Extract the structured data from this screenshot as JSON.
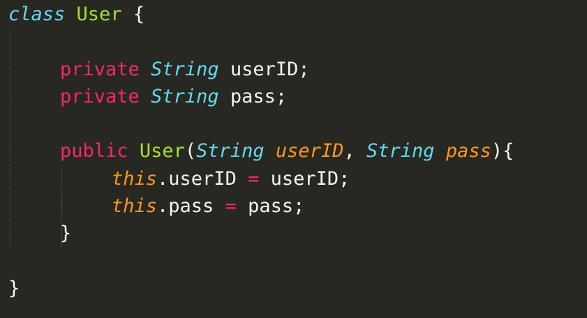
{
  "code": {
    "line1": {
      "keyword": "class",
      "name": "User",
      "brace": "{"
    },
    "line2": {
      "modifier": "private",
      "type": "String",
      "ident": "userID;"
    },
    "line3": {
      "modifier": "private",
      "type": "String",
      "ident": "pass;"
    },
    "line4": {
      "modifier": "public",
      "name": "User",
      "open": "(",
      "type1": "String",
      "param1": "userID",
      "comma": ",",
      "type2": "String",
      "param2": "pass",
      "close": "){"
    },
    "line5": {
      "this": "this",
      "field": ".userID",
      "op": "=",
      "value": "userID;"
    },
    "line6": {
      "this": "this",
      "field": ".pass",
      "op": "=",
      "value": "pass;"
    },
    "line7": {
      "brace": "}"
    },
    "line8": {
      "brace": "}"
    }
  },
  "colors": {
    "background": "#272822",
    "keyword": "#66d9ef",
    "class_name": "#a6e22e",
    "modifier": "#f92672",
    "parameter": "#fd971f",
    "text": "#f8f8f2"
  }
}
